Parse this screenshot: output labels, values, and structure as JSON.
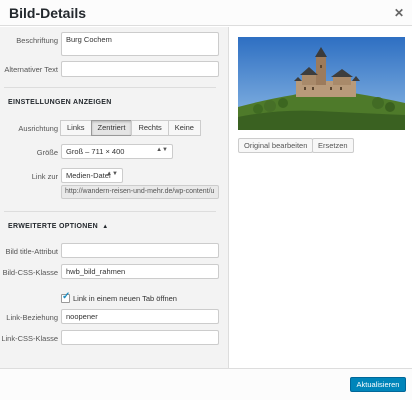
{
  "dialog": {
    "title": "Bild-Details"
  },
  "fields": {
    "caption_label": "Beschriftung",
    "caption_value": "Burg Cochem",
    "alt_label": "Alternativer Text",
    "alt_value": ""
  },
  "display": {
    "section_title": "EINSTELLUNGEN ANZEIGEN",
    "align_label": "Ausrichtung",
    "align_options": [
      "Links",
      "Zentriert",
      "Rechts",
      "Keine"
    ],
    "align_selected": "Zentriert",
    "size_label": "Größe",
    "size_value": "Groß – 711 × 400",
    "link_label": "Link zur",
    "link_value": "Medien-Datei",
    "link_url": "http://wandern-reisen-und-mehr.de/wp-content/u"
  },
  "advanced": {
    "section_title": "ERWEITERTE OPTIONEN",
    "title_attr_label": "Bild title-Attribut",
    "title_attr_value": "",
    "css_class_label": "Bild-CSS-Klasse",
    "css_class_value": "hwb_bild_rahmen",
    "new_tab_label": "Link in einem neuen Tab öffnen",
    "new_tab_checked": true,
    "rel_label": "Link-Beziehung",
    "rel_value": "noopener",
    "link_css_label": "Link-CSS-Klasse",
    "link_css_value": ""
  },
  "preview": {
    "edit_label": "Original bearbeiten",
    "replace_label": "Ersetzen"
  },
  "footer": {
    "update_label": "Aktualisieren"
  },
  "icons": {
    "close": "close-icon",
    "select_arrow": "updown-arrow-icon",
    "expand": "triangle-up-icon",
    "checkmark": "checkmark-icon"
  },
  "colors": {
    "primary": "#0085ba",
    "checkmark": "#1e8cbe",
    "panel_bg": "#f3f3f3"
  }
}
